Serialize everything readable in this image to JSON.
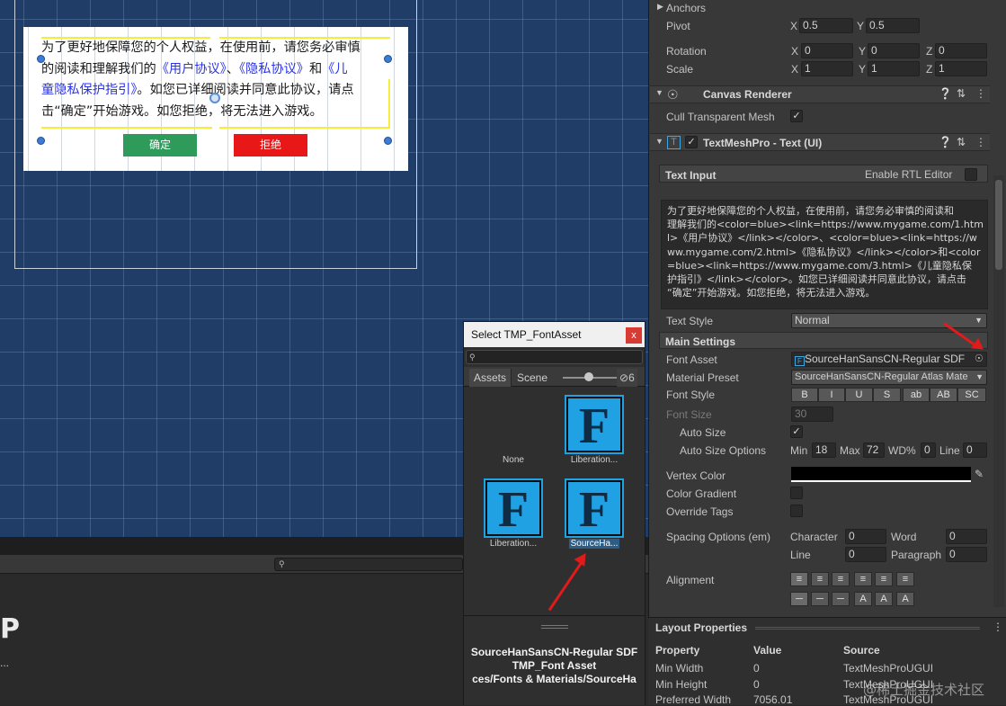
{
  "scene": {
    "dialog": {
      "text_line1": "为了更好地保障您的个人权益，在使用前，请您务必审慎",
      "text_line2_a": "的阅读和理解我们的",
      "link1": "《用户协议》",
      "sep1": "、",
      "link2": "《隐私协议》",
      "sep2": "和",
      "link3_a": "《儿",
      "link3_b": "童隐私保护指引》",
      "text_line3_b": "。如您已详细阅读并同意此协议，请点",
      "text_line4": "击“确定”开始游戏。如您拒绝，将无法进入游戏。",
      "ok_label": "确定",
      "reject_label": "拒绝"
    }
  },
  "bottom": {
    "logo": "P",
    "ellipsis": "..."
  },
  "popup": {
    "title": "Select TMP_FontAsset",
    "close": "x",
    "search_icon": "search-icon",
    "tabs": [
      "Assets",
      "Scene"
    ],
    "hidden_count": "6",
    "items": [
      {
        "label": "None",
        "has_icon": false
      },
      {
        "label": "Liberation...",
        "icon": "F"
      },
      {
        "label": "Liberation...",
        "icon": "F"
      },
      {
        "label": "SourceHa...",
        "icon": "F",
        "selected": true
      }
    ],
    "info_line1": "SourceHanSansCN-Regular SDF",
    "info_line2": "TMP_Font Asset",
    "info_line3": "ces/Fonts & Materials/SourceHa"
  },
  "inspector": {
    "anchors": "Anchors",
    "pivot": {
      "label": "Pivot",
      "x": "0.5",
      "y": "0.5"
    },
    "rotation": {
      "label": "Rotation",
      "x": "0",
      "y": "0",
      "z": "0"
    },
    "scale": {
      "label": "Scale",
      "x": "1",
      "y": "1",
      "z": "1"
    },
    "axis": {
      "x": "X",
      "y": "Y",
      "z": "Z"
    },
    "canvas_renderer": "Canvas Renderer",
    "cull_transparent_mesh": "Cull Transparent Mesh",
    "tmp_component": "TextMeshPro - Text (UI)",
    "tmp_icon": "T",
    "text_input": "Text Input",
    "enable_rtl": "Enable RTL Editor",
    "text_lines": [
      "为了更好地保障您的个人权益，在使用前，请您务必审慎的阅读和",
      "理解我们的<color=blue><link=https://www.mygame.com/1.htm",
      "l>《用户协议》</link></color>、<color=blue><link=https://w",
      "ww.mygame.com/2.html>《隐私协议》</link></color>和<color",
      "=blue><link=https://www.mygame.com/3.html>《儿童隐私保",
      "护指引》</link></color>。如您已详细阅读并同意此协议，请点击",
      "“确定”开始游戏。如您拒绝，将无法进入游戏。"
    ],
    "text_style": {
      "label": "Text Style",
      "value": "Normal"
    },
    "main_settings": "Main Settings",
    "font_asset": {
      "label": "Font Asset",
      "value": "SourceHanSansCN-Regular SDF"
    },
    "material_preset": {
      "label": "Material Preset",
      "value": "SourceHanSansCN-Regular Atlas Mate"
    },
    "font_style": {
      "label": "Font Style",
      "buttons": [
        "B",
        "I",
        "U",
        "S",
        "ab",
        "AB",
        "SC"
      ]
    },
    "font_size": {
      "label": "Font Size",
      "value": "30"
    },
    "auto_size": "Auto Size",
    "auto_size_options": {
      "label": "Auto Size Options",
      "min_label": "Min",
      "min": "18",
      "max_label": "Max",
      "max": "72",
      "wd_label": "WD%",
      "wd": "0",
      "line_label": "Line",
      "line": "0"
    },
    "vertex_color": "Vertex Color",
    "color_gradient": "Color Gradient",
    "override_tags": "Override Tags",
    "spacing": {
      "label": "Spacing Options (em)",
      "character_label": "Character",
      "character": "0",
      "word_label": "Word",
      "word": "0",
      "line_label": "Line",
      "line": "0",
      "paragraph_label": "Paragraph",
      "paragraph": "0"
    },
    "alignment": "Alignment",
    "layout_properties": "Layout Properties",
    "layout_headers": [
      "Property",
      "Value",
      "Source"
    ],
    "layout_rows": [
      {
        "property": "Min Width",
        "value": "0",
        "source": "TextMeshProUGUI"
      },
      {
        "property": "Min Height",
        "value": "0",
        "source": "TextMeshProUGUI"
      },
      {
        "property": "Preferred Width",
        "value": "7056.01",
        "source": "TextMeshProUGUI"
      }
    ]
  },
  "watermark": "@稀土掘金技术社区",
  "colors": {
    "link": "#2b34e6",
    "ok": "#2e9b5a",
    "reject": "#e81818",
    "arrow": "#e11b1b",
    "font_icon": "#1fa1e4"
  }
}
